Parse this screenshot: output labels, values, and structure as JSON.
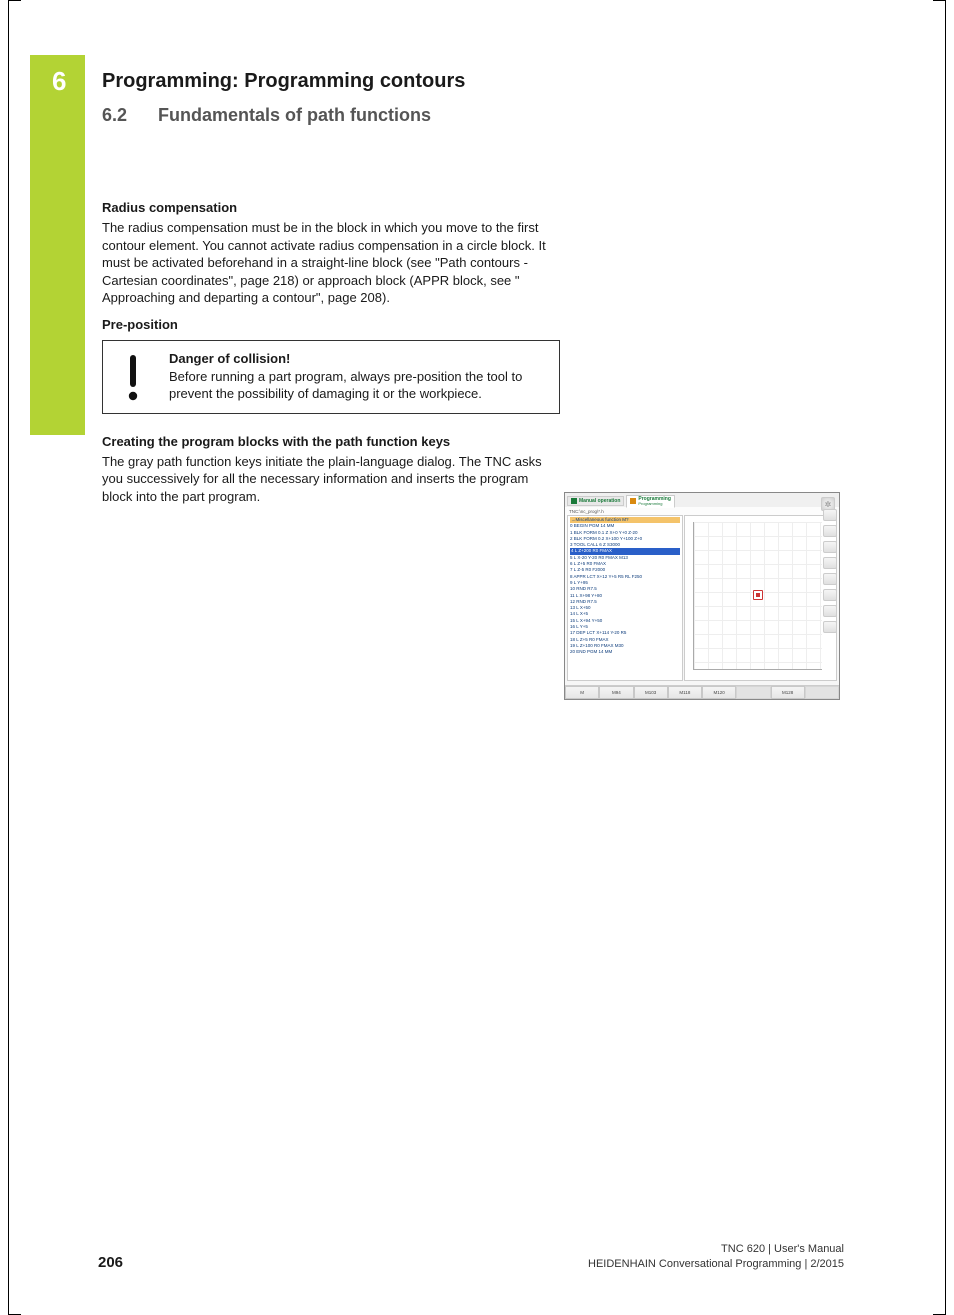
{
  "chapter": {
    "number": "6",
    "title": "Programming: Programming contours"
  },
  "section": {
    "number": "6.2",
    "title": "Fundamentals of path functions"
  },
  "h1": "Radius compensation",
  "p1": "The radius compensation must be in the block in which you move to the first contour element. You cannot activate radius compensation in a circle block. It must be activated beforehand in a straight-line block (see \"Path contours - Cartesian coordinates\", page 218) or approach block (APPR block, see \" Approaching and departing a contour\", page 208).",
  "h2": "Pre-position",
  "callout": {
    "title": "Danger of collision!",
    "body": "Before running a part program, always pre-position the tool to prevent the possibility of damaging it or the workpiece."
  },
  "h3": "Creating the program blocks with the path function keys",
  "p3": "The gray path function keys initiate the plain-language dialog. The TNC asks you successively for all the necessary information and inserts the program block into the part program.",
  "figure": {
    "tabs": {
      "manual": "Manual operation",
      "programming": "Programming",
      "sub": "Programming"
    },
    "path": "TNC:\\nc_prog\\*.h",
    "code_header": "→Miscellaneous function M?",
    "code_lines": [
      "0  BEGIN PGM 14 MM",
      "1  BLK FORM 0.1 Z X+0 Y+0 Z-20",
      "2  BLK FORM 0.2  X+100  Y+100  Z+0",
      "3  TOOL CALL 6 Z S3000",
      "5  L  X-20  Y-20 R0  FMAX M13",
      "6  L  Z+5 R0 FMAX",
      "7  L  Z-5 R0 F2000",
      "8  APPR LCT  X+12  Y+5 R5 RL F250",
      "9  L  Y+95",
      "10 RND R7.5",
      "11 L  X+98  Y+80",
      "12 RND R7.5",
      "13 L  X+50",
      "14 L  X+5",
      "15 L  X+94  Y+50",
      "16 L  Y+5",
      "17 DEP LCT  X+114  Y-20 R5",
      "18 L  Z+5 R0 FMAX",
      "19 L  Z+100 R0 FMAX M30",
      "20 END PGM 14 MM"
    ],
    "highlight_line": "4  L Z+200 R0 FMAX",
    "softkeys": [
      "M",
      "M94",
      "M103",
      "M118",
      "M120",
      "",
      "M128",
      ""
    ]
  },
  "footer": {
    "page": "206",
    "line1": "TNC 620 | User's Manual",
    "line2": "HEIDENHAIN Conversational Programming | 2/2015"
  }
}
